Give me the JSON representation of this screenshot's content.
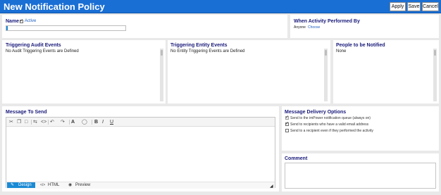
{
  "header": {
    "title": "New Notification Policy",
    "buttons": {
      "apply": "Apply",
      "save": "Save",
      "cancel": "Cancel"
    }
  },
  "name_panel": {
    "label": "Name",
    "active_label": "Active",
    "active_checked": true,
    "name_value": ""
  },
  "when_panel": {
    "title": "When Activity Performed By",
    "value": "Anyone",
    "link": "Choose"
  },
  "audit_panel": {
    "title": "Triggering Audit Events",
    "empty_text": "No Audit Triggering Events are Defined"
  },
  "entity_panel": {
    "title": "Triggering Entity Events",
    "empty_text": "No Entity Triggering Events are Defined"
  },
  "people_panel": {
    "title": "People to be Notified",
    "value": "None"
  },
  "message_panel": {
    "title": "Message To Send",
    "toolbar_icons": [
      "cut-icon",
      "copy-icon",
      "paste-icon",
      "find-replace-icon",
      "source-icon",
      "undo-icon",
      "redo-icon",
      "font-color-icon",
      "highlight-icon",
      "bold-icon",
      "italic-icon",
      "underline-icon"
    ],
    "toolbar_glyphs": {
      "font": "A",
      "bold": "B",
      "italic": "I",
      "underline": "U"
    },
    "modes": {
      "design": "Design",
      "html": "HTML",
      "preview": "Preview"
    },
    "active_mode": "Design"
  },
  "delivery_panel": {
    "title": "Message Delivery Options",
    "options": [
      {
        "label": "Send to the imPower notification queue (always on)",
        "checked": true,
        "disabled": true
      },
      {
        "label": "Send to recipients who have a valid email address",
        "checked": true,
        "disabled": false
      },
      {
        "label": "Send to a recipient even if they performed the activity",
        "checked": false,
        "disabled": false
      }
    ]
  },
  "comment_panel": {
    "title": "Comment",
    "value": ""
  },
  "colors": {
    "titlebar": "#1a6fd4",
    "panel_title": "#19197a",
    "accent": "#1a8ad4",
    "link": "#1f5fbf"
  }
}
